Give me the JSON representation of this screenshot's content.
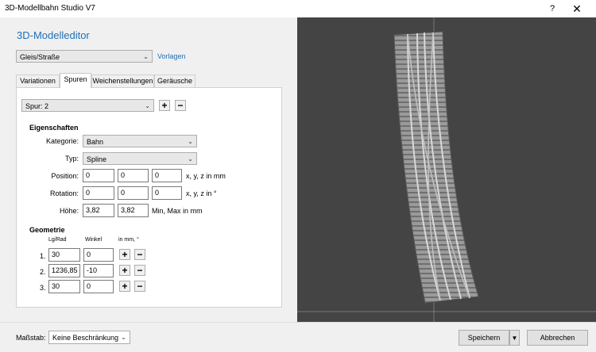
{
  "window": {
    "title": "3D-Modellbahn Studio V7",
    "help": "?",
    "close": "✕"
  },
  "editor": {
    "heading": "3D-Modelleditor",
    "type_select": "Gleis/Straße",
    "vorlagen_link": "Vorlagen",
    "tabs": [
      "Variationen",
      "Spuren",
      "Weichenstellungen",
      "Geräusche"
    ],
    "active_tab": 1,
    "spur_select": "Spur: 2",
    "add": "+",
    "remove": "−",
    "eigenschaften": {
      "title": "Eigenschaften",
      "kategorie_label": "Kategorie:",
      "kategorie_value": "Bahn",
      "typ_label": "Typ:",
      "typ_value": "Spline",
      "position_label": "Position:",
      "position": [
        "0",
        "0",
        "0"
      ],
      "position_unit": "x, y, z in mm",
      "rotation_label": "Rotation:",
      "rotation": [
        "0",
        "0",
        "0"
      ],
      "rotation_unit": "x, y, z in °",
      "hoehe_label": "Höhe:",
      "hoehe": [
        "3,82",
        "3,82"
      ],
      "hoehe_unit": "Min, Max in mm"
    },
    "geometrie": {
      "title": "Geometrie",
      "col_lg": "Lg/Rad",
      "col_winkel": "Winkel",
      "col_unit": "in mm, °",
      "rows": [
        {
          "num": "1.",
          "lg": "30",
          "winkel": "0"
        },
        {
          "num": "2.",
          "lg": "1236,85",
          "winkel": "-10"
        },
        {
          "num": "3.",
          "lg": "30",
          "winkel": "0"
        }
      ]
    }
  },
  "footer": {
    "massstab_label": "Maßstab:",
    "massstab_value": "Keine Beschränkung",
    "save": "Speichern",
    "cancel": "Abbrechen"
  },
  "colors": {
    "accent": "#1f6fb5",
    "viewport_bg": "#444444"
  }
}
